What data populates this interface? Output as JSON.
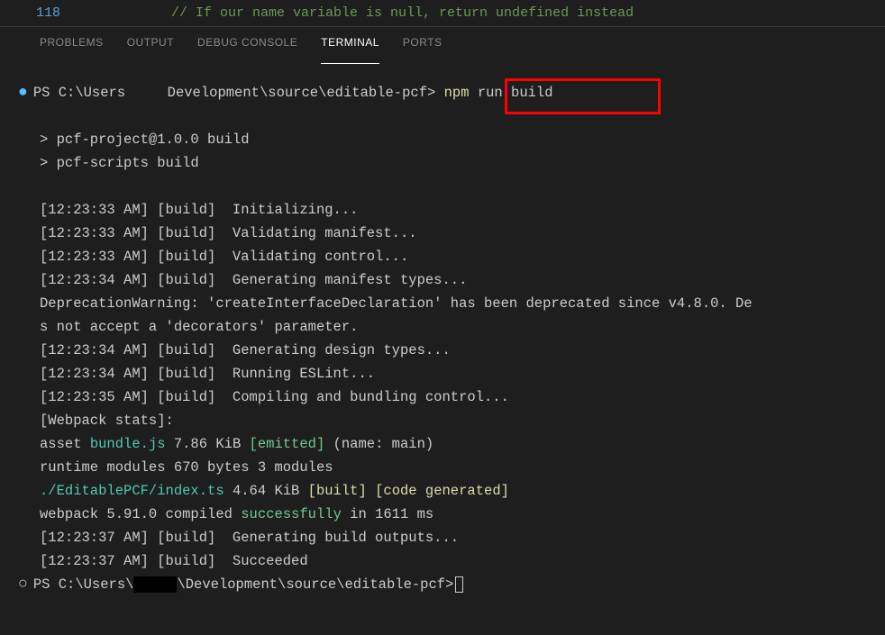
{
  "editor": {
    "line_number": "118",
    "comment": "// If our name variable is null, return undefined instead"
  },
  "tabs": {
    "problems": "PROBLEMS",
    "output": "OUTPUT",
    "debug_console": "DEBUG CONSOLE",
    "terminal": "TERMINAL",
    "ports": "PORTS"
  },
  "terminal": {
    "prompt1_a": "PS C:\\Users",
    "prompt1_b": "     Development\\source\\editable-pcf>",
    "cmd_npm": " npm",
    "cmd_rest": " run build",
    "l1": "> pcf-project@1.0.0 build",
    "l2": "> pcf-scripts build",
    "l3": "[12:23:33 AM] [build]  Initializing...",
    "l4": "[12:23:33 AM] [build]  Validating manifest...",
    "l5": "[12:23:33 AM] [build]  Validating control...",
    "l6": "[12:23:34 AM] [build]  Generating manifest types...",
    "l7": "DeprecationWarning: 'createInterfaceDeclaration' has been deprecated since v4.8.0. De",
    "l8": "s not accept a 'decorators' parameter.",
    "l9": "[12:23:34 AM] [build]  Generating design types...",
    "l10": "[12:23:34 AM] [build]  Running ESLint...",
    "l11": "[12:23:35 AM] [build]  Compiling and bundling control...",
    "l12": "[Webpack stats]:",
    "asset_a": "asset ",
    "asset_b": "bundle.js",
    "asset_c": " 7.86 KiB ",
    "asset_d": "[emitted]",
    "asset_e": " (name: main)",
    "l14": "runtime modules 670 bytes 3 modules",
    "built_a": "./EditablePCF/index.ts",
    "built_b": " 4.64 KiB ",
    "built_c": "[built]",
    "built_d": " ",
    "built_e": "[code generated]",
    "comp_a": "webpack 5.91.0 compiled ",
    "comp_b": "successfully",
    "comp_c": " in 1611 ms",
    "l17": "[12:23:37 AM] [build]  Generating build outputs...",
    "l18": "[12:23:37 AM] [build]  Succeeded",
    "prompt2_a": "PS C:\\Users\\",
    "prompt2_b": "\\Development\\source\\editable-pcf>"
  }
}
